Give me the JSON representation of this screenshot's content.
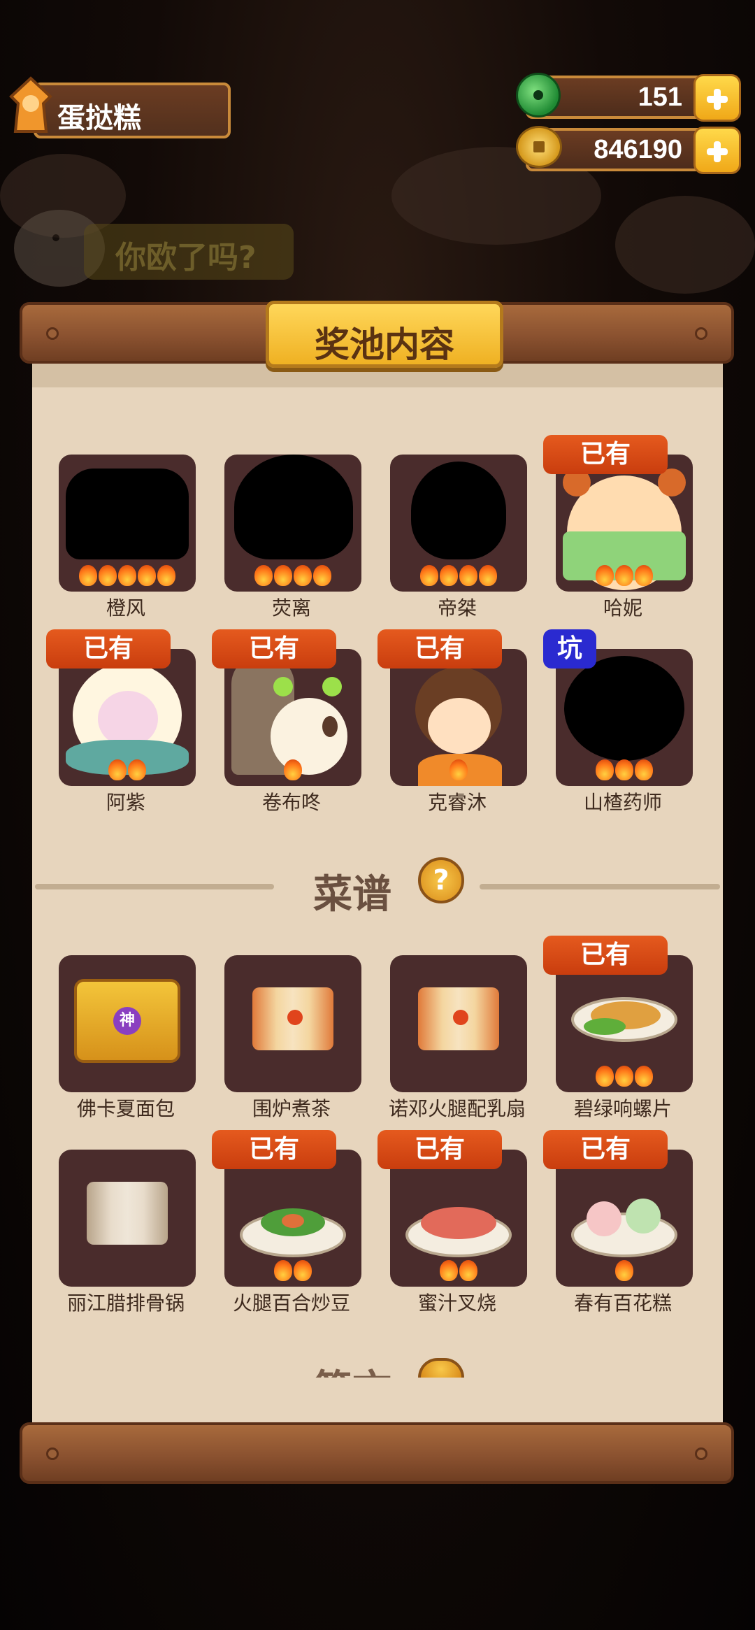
{
  "player": {
    "name": "蛋挞糕"
  },
  "resources": {
    "jade": "151",
    "coins": "846190"
  },
  "background": {
    "banner_text": "你欧了吗?"
  },
  "panel": {
    "title": "奖池内容",
    "characters": [
      {
        "name": "橙风",
        "owned": false,
        "flames": 5
      },
      {
        "name": "荧离",
        "owned": false,
        "flames": 4
      },
      {
        "name": "帝桀",
        "owned": false,
        "flames": 4
      },
      {
        "name": "哈妮",
        "owned": true,
        "flames": 3
      },
      {
        "name": "阿紫",
        "owned": true,
        "flames": 2
      },
      {
        "name": "卷布咚",
        "owned": true,
        "flames": 1
      },
      {
        "name": "克睿沐",
        "owned": true,
        "flames": 1
      },
      {
        "name": "山楂药师",
        "owned": false,
        "flames": 3
      }
    ],
    "badges": {
      "owned": "已有",
      "pit": "坑"
    },
    "recipes_section": "菜谱",
    "recipes": [
      {
        "name": "佛卡夏面包",
        "owned": false,
        "flames": 0,
        "seal": "神"
      },
      {
        "name": "围炉煮茶",
        "owned": false,
        "flames": 0
      },
      {
        "name": "诺邓火腿配乳扇",
        "owned": false,
        "flames": 0
      },
      {
        "name": "碧绿响螺片",
        "owned": true,
        "flames": 3
      },
      {
        "name": "丽江腊排骨锅",
        "owned": false,
        "flames": 0
      },
      {
        "name": "火腿百合炒豆",
        "owned": true,
        "flames": 2
      },
      {
        "name": "蜜汁叉烧",
        "owned": true,
        "flames": 2
      },
      {
        "name": "春有百花糕",
        "owned": true,
        "flames": 1
      }
    ],
    "next_section_partial": "简文",
    "help_symbol": "?"
  }
}
